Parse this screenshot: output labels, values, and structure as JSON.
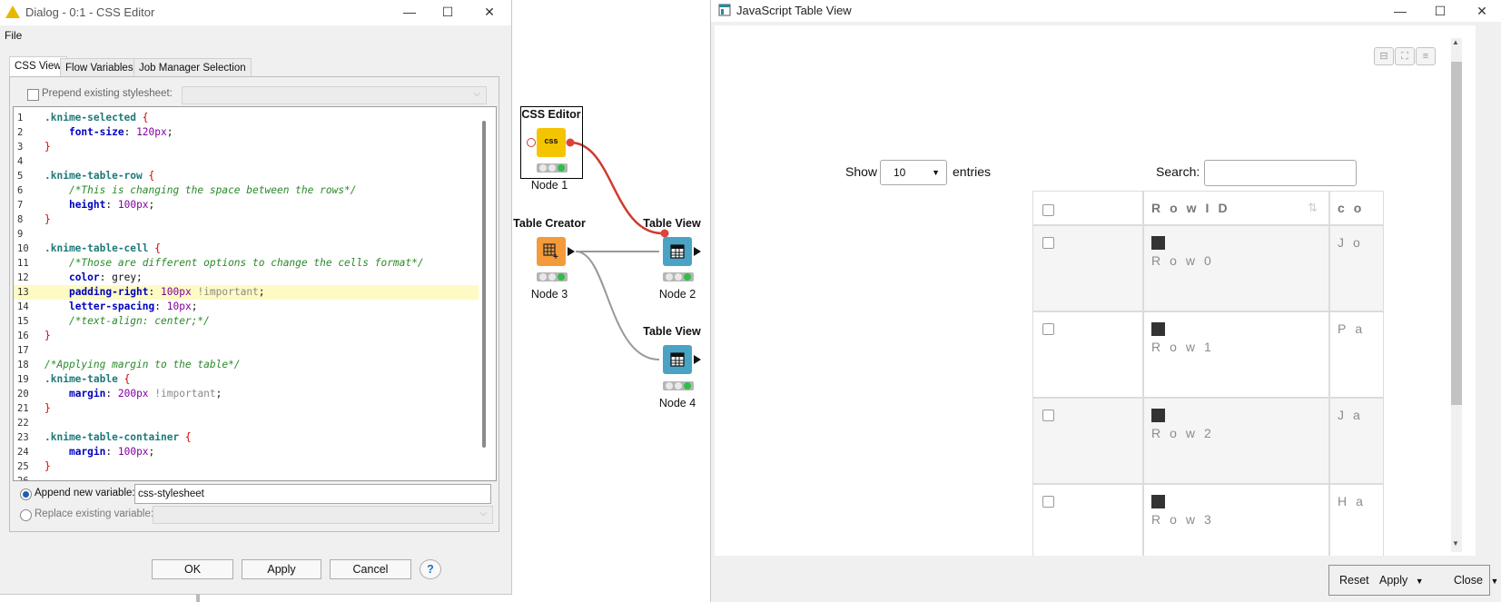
{
  "dialog": {
    "title": "Dialog - 0:1 - CSS Editor",
    "menu_file": "File",
    "tabs": [
      "CSS View",
      "Flow Variables",
      "Job Manager Selection"
    ],
    "prepend_label": "Prepend existing stylesheet:",
    "append_label": "Append new variable:",
    "append_value": "css-stylesheet",
    "replace_label": "Replace existing variable:",
    "buttons": {
      "ok": "OK",
      "apply": "Apply",
      "cancel": "Cancel",
      "help": "?"
    },
    "window": {
      "minimize": "—",
      "maximize": "☐",
      "close": "✕"
    },
    "code_lines": [
      [
        {
          "t": ".knime-selected ",
          "c": "sel"
        },
        {
          "t": "{",
          "c": "brace"
        }
      ],
      [
        {
          "t": "    "
        },
        {
          "t": "font-size",
          "c": "prop"
        },
        {
          "t": ": "
        },
        {
          "t": "120px",
          "c": "num"
        },
        {
          "t": ";"
        }
      ],
      [
        {
          "t": "}",
          "c": "brace"
        }
      ],
      [],
      [
        {
          "t": ".knime-table-row ",
          "c": "sel"
        },
        {
          "t": "{",
          "c": "brace"
        }
      ],
      [
        {
          "t": "    "
        },
        {
          "t": "/*This is changing the space between the rows*/",
          "c": "cmt"
        }
      ],
      [
        {
          "t": "    "
        },
        {
          "t": "height",
          "c": "prop"
        },
        {
          "t": ": "
        },
        {
          "t": "100px",
          "c": "num"
        },
        {
          "t": ";"
        }
      ],
      [
        {
          "t": "}",
          "c": "brace"
        }
      ],
      [],
      [
        {
          "t": ".knime-table-cell ",
          "c": "sel"
        },
        {
          "t": "{",
          "c": "brace"
        }
      ],
      [
        {
          "t": "    "
        },
        {
          "t": "/*Those are different options to change the cells format*/",
          "c": "cmt"
        }
      ],
      [
        {
          "t": "    "
        },
        {
          "t": "color",
          "c": "prop"
        },
        {
          "t": ": grey;"
        }
      ],
      [
        {
          "t": "    "
        },
        {
          "t": "padding-right",
          "c": "prop"
        },
        {
          "t": ": "
        },
        {
          "t": "100px",
          "c": "num"
        },
        {
          "t": " "
        },
        {
          "t": "!important",
          "c": "imp"
        },
        {
          "t": ";"
        }
      ],
      [
        {
          "t": "    "
        },
        {
          "t": "letter-spacing",
          "c": "prop"
        },
        {
          "t": ": "
        },
        {
          "t": "10px",
          "c": "num"
        },
        {
          "t": ";"
        }
      ],
      [
        {
          "t": "    "
        },
        {
          "t": "/*text-align: center;*/",
          "c": "cmt"
        }
      ],
      [
        {
          "t": "}",
          "c": "brace"
        }
      ],
      [],
      [
        {
          "t": "/*Applying margin to the table*/",
          "c": "cmt"
        }
      ],
      [
        {
          "t": ".knime-table ",
          "c": "sel"
        },
        {
          "t": "{",
          "c": "brace"
        }
      ],
      [
        {
          "t": "    "
        },
        {
          "t": "margin",
          "c": "prop"
        },
        {
          "t": ": "
        },
        {
          "t": "200px",
          "c": "num"
        },
        {
          "t": " "
        },
        {
          "t": "!important",
          "c": "imp"
        },
        {
          "t": ";"
        }
      ],
      [
        {
          "t": "}",
          "c": "brace"
        }
      ],
      [],
      [
        {
          "t": ".knime-table-container ",
          "c": "sel"
        },
        {
          "t": "{",
          "c": "brace"
        }
      ],
      [
        {
          "t": "    "
        },
        {
          "t": "margin",
          "c": "prop"
        },
        {
          "t": ": "
        },
        {
          "t": "100px",
          "c": "num"
        },
        {
          "t": ";"
        }
      ],
      [
        {
          "t": "}",
          "c": "brace"
        }
      ],
      []
    ],
    "highlighted_line": 13
  },
  "workflow": {
    "css_editor": {
      "name": "CSS Editor",
      "icon_text": "css",
      "label": "Node 1"
    },
    "table_creator": {
      "name": "Table Creator",
      "label": "Node 3"
    },
    "table_view_1": {
      "name": "Table View",
      "label": "Node 2"
    },
    "table_view_2": {
      "name": "Table View",
      "label": "Node 4"
    }
  },
  "jsview": {
    "title": "JavaScript Table View",
    "show_label": "Show",
    "entries_value": "10",
    "entries_label": "entries",
    "search_label": "Search:",
    "col_rowid": "RowID",
    "col_partial": "co",
    "rows": [
      {
        "id": "Row0",
        "partial": "Jo"
      },
      {
        "id": "Row1",
        "partial": "Pa"
      },
      {
        "id": "Row2",
        "partial": "Ja"
      },
      {
        "id": "Row3",
        "partial": "Ha"
      }
    ],
    "buttons": {
      "reset": "Reset",
      "apply": "Apply",
      "close": "Close"
    },
    "colors": {
      "node_css": "#f5c400",
      "node_creator": "#f39b3a",
      "node_view": "#4aa3c4",
      "connection_red": "#d03a2f"
    }
  }
}
